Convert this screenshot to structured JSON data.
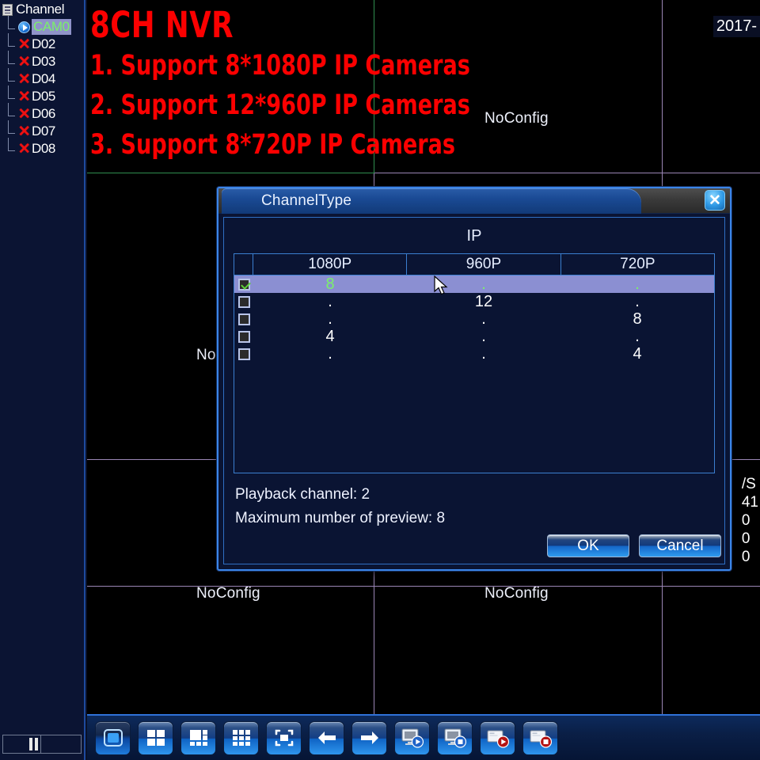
{
  "sidebar": {
    "header_label": "Channel",
    "header_icon": "document-icon",
    "items": [
      {
        "label": "CAM0",
        "icon": "play-circle-icon",
        "state": "active"
      },
      {
        "label": "D02",
        "icon": "red-x-icon",
        "state": "offline"
      },
      {
        "label": "D03",
        "icon": "red-x-icon",
        "state": "offline"
      },
      {
        "label": "D04",
        "icon": "red-x-icon",
        "state": "offline"
      },
      {
        "label": "D05",
        "icon": "red-x-icon",
        "state": "offline"
      },
      {
        "label": "D06",
        "icon": "red-x-icon",
        "state": "offline"
      },
      {
        "label": "D07",
        "icon": "red-x-icon",
        "state": "offline"
      },
      {
        "label": "D08",
        "icon": "red-x-icon",
        "state": "offline"
      }
    ],
    "status_icon": "pause-icon"
  },
  "video": {
    "timestamp": "2017-",
    "promo": {
      "title": "8CH NVR",
      "lines": [
        "1. Support 8*1080P IP Cameras",
        "2. Support 12*960P IP Cameras",
        "3. Support 8*720P IP Cameras"
      ]
    },
    "no_config_label": "NoConfig",
    "cells": [
      {
        "label": "NoConfig"
      },
      {
        "label": "NoConfig"
      },
      {
        "label": "NoConfig"
      },
      {
        "label": "NoConfig"
      },
      {
        "label": "NoConfig"
      }
    ],
    "right_stats": [
      "/S",
      "41",
      "0",
      "0",
      "0"
    ]
  },
  "toolbar": {
    "buttons": [
      {
        "name": "single-view-button",
        "icon": "single-screen-icon"
      },
      {
        "name": "quad-view-button",
        "icon": "four-split-icon"
      },
      {
        "name": "six-view-button",
        "icon": "six-split-icon"
      },
      {
        "name": "nine-view-button",
        "icon": "nine-split-icon"
      },
      {
        "name": "fullscreen-button",
        "icon": "fullscreen-icon"
      },
      {
        "name": "previous-button",
        "icon": "arrow-left-icon"
      },
      {
        "name": "next-button",
        "icon": "arrow-right-icon"
      },
      {
        "name": "start-all-preview-button",
        "icon": "monitor-play-icon"
      },
      {
        "name": "stop-all-preview-button",
        "icon": "monitor-stop-icon"
      },
      {
        "name": "start-record-button",
        "icon": "record-play-icon"
      },
      {
        "name": "stop-record-button",
        "icon": "record-stop-icon"
      }
    ]
  },
  "dialog": {
    "title": "ChannelType",
    "close_icon": "close-icon",
    "group_label": "IP",
    "columns": [
      "1080P",
      "960P",
      "720P"
    ],
    "rows": [
      {
        "checked": true,
        "values": [
          "8",
          ".",
          "."
        ]
      },
      {
        "checked": false,
        "values": [
          ".",
          "12",
          "."
        ]
      },
      {
        "checked": false,
        "values": [
          ".",
          ".",
          "8"
        ]
      },
      {
        "checked": false,
        "values": [
          "4",
          ".",
          "."
        ]
      },
      {
        "checked": false,
        "values": [
          ".",
          ".",
          "4"
        ]
      }
    ],
    "info": [
      "Playback channel: 2",
      "Maximum number of preview: 8"
    ],
    "ok_label": "OK",
    "cancel_label": "Cancel"
  },
  "colors": {
    "accent": "#3b85e8",
    "selected_row": "#8b8fd2",
    "checked_green": "#5ed13a",
    "promo_red": "#fc0000",
    "offline_red": "#ef1111"
  }
}
